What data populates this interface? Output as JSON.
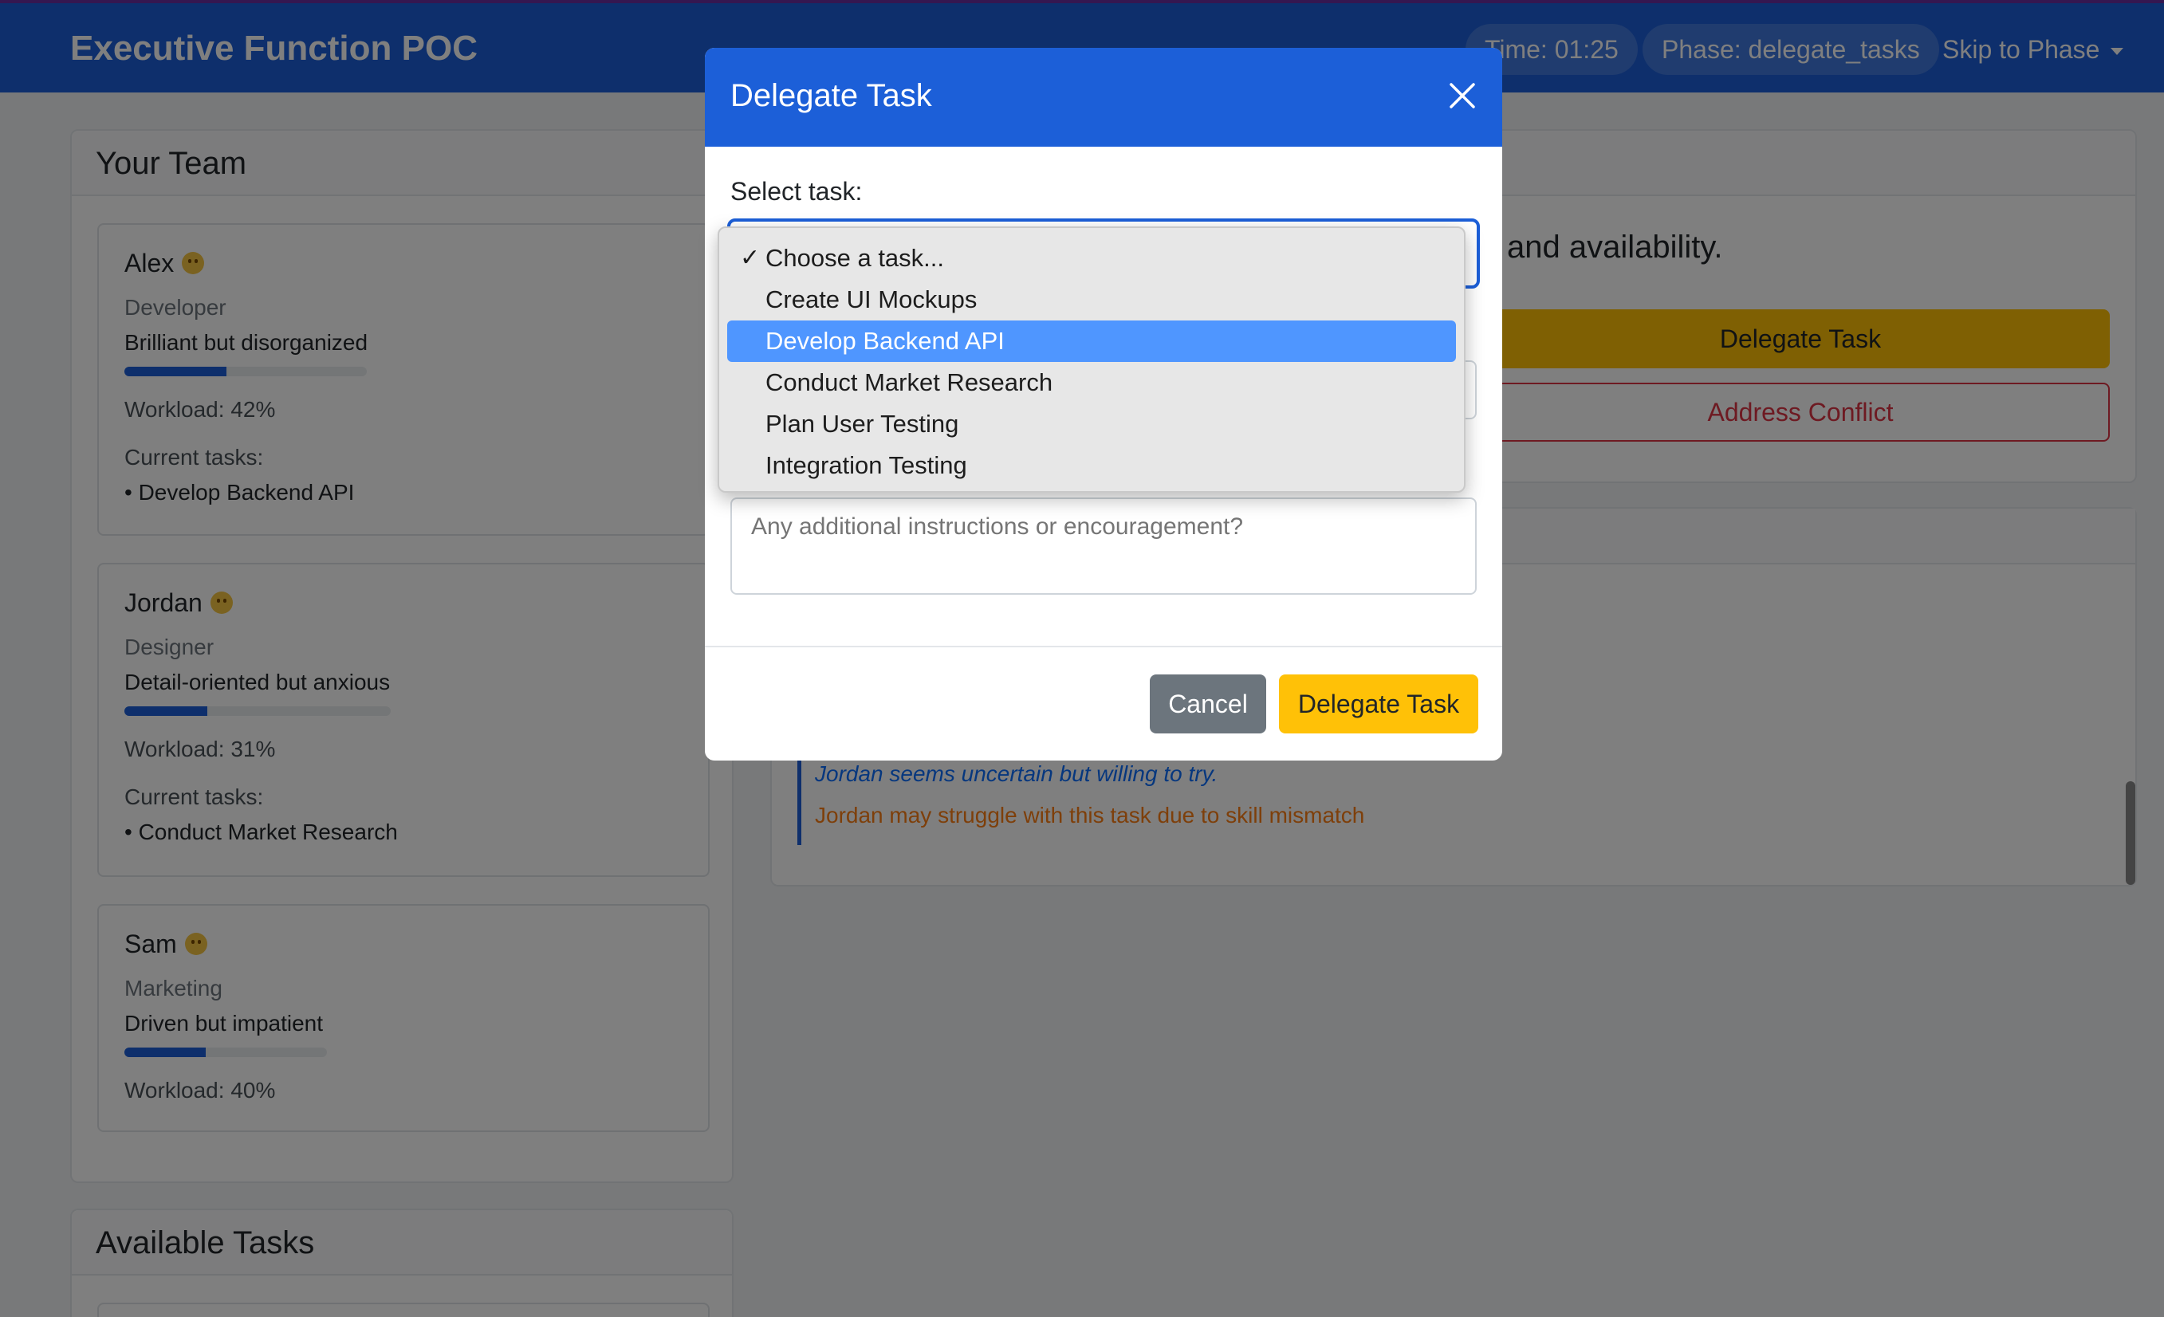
{
  "header": {
    "brand": "Executive Function POC",
    "timer": "Time: 01:25",
    "phase": "Phase: delegate_tasks",
    "skip_label": "Skip to Phase"
  },
  "team": {
    "title": "Your Team",
    "members": [
      {
        "name": "Alex",
        "role": "Developer",
        "trait": "Brilliant but disorganized",
        "workload": 0.42,
        "workload_label": "Workload: 42%",
        "tasks_label": "Current tasks:",
        "task": "• Develop Backend API"
      },
      {
        "name": "Jordan",
        "role": "Designer",
        "trait": "Detail-oriented but anxious",
        "workload": 0.31,
        "workload_label": "Workload: 31%",
        "tasks_label": "Current tasks:",
        "task": "• Conduct Market Research"
      },
      {
        "name": "Sam",
        "role": "Marketing",
        "trait": "Driven but impatient",
        "workload": 0.4,
        "workload_label": "Workload: 40%"
      }
    ]
  },
  "available_tasks": {
    "title": "Available Tasks"
  },
  "right_panel": {
    "text_fragment": "and availability.",
    "delegate_label": "Delegate Task",
    "conflict_label": "Address Conflict"
  },
  "log": {
    "line1": "Jordan seems uncertain but willing to try.",
    "line2": "Jordan may struggle with this task due to skill mismatch"
  },
  "modal": {
    "title": "Delegate Task",
    "select_label": "Select task:",
    "options": [
      "Choose a task...",
      "Create UI Mockups",
      "Develop Backend API",
      "Conduct Market Research",
      "Plan User Testing",
      "Integration Testing"
    ],
    "checked_option": "Choose a task...",
    "highlighted_option": "Develop Backend API",
    "check_mark": "✓",
    "message_placeholder": "Any additional instructions or encouragement?",
    "cancel_label": "Cancel",
    "submit_label": "Delegate Task"
  },
  "colors": {
    "primary": "#1c5fd8",
    "warning": "#ffc107",
    "danger": "#dc3545",
    "secondary": "#6c757d",
    "highlight": "#4f96ff"
  }
}
